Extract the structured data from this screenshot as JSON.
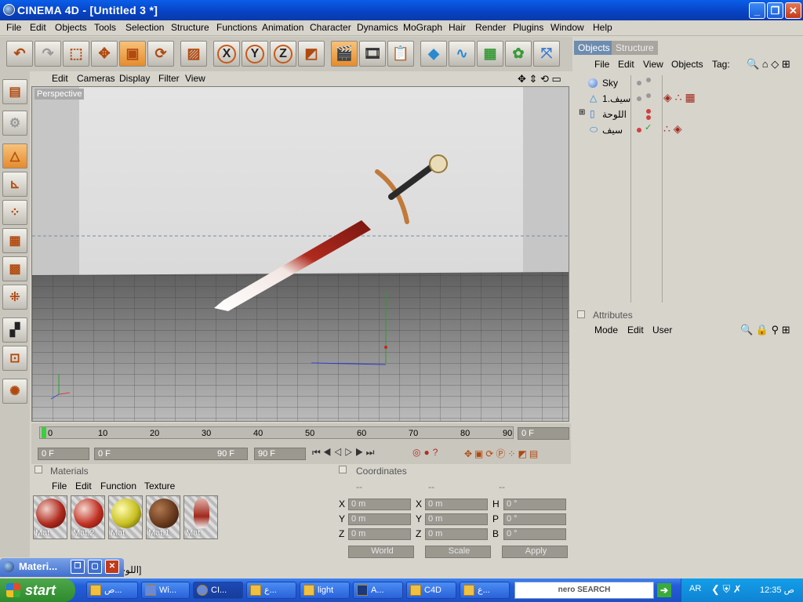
{
  "window": {
    "title": "CINEMA 4D - [Untitled 3 *]"
  },
  "menubar": [
    "File",
    "Edit",
    "Objects",
    "Tools",
    "Selection",
    "Structure",
    "Functions",
    "Animation",
    "Character",
    "Dynamics",
    "MoGraph",
    "Hair",
    "Render",
    "Plugins",
    "Window",
    "Help"
  ],
  "viewport": {
    "menu": [
      "Edit",
      "Cameras",
      "Display",
      "Filter",
      "View"
    ],
    "label": "Perspective"
  },
  "timeline": {
    "ticks": [
      "0",
      "10",
      "20",
      "30",
      "40",
      "50",
      "60",
      "70",
      "80",
      "90"
    ],
    "current_frame": "0 F",
    "start_frame": "0 F",
    "range_start": "0 F",
    "range_end": "90 F",
    "end_frame": "90 F"
  },
  "materials": {
    "title": "Materials",
    "menu": [
      "File",
      "Edit",
      "Function",
      "Texture"
    ],
    "items": [
      {
        "name": "Mat",
        "color": "#b02a1e"
      },
      {
        "name": "Mat.2",
        "color": "#c23224"
      },
      {
        "name": "Mat",
        "color": "#c8c020"
      },
      {
        "name": "Mat.1",
        "color": "#6a3a1e"
      },
      {
        "name": "Mat",
        "color": "#a0281c"
      }
    ]
  },
  "coordinates": {
    "title": "Coordinates",
    "headers": [
      "--",
      "--",
      "--"
    ],
    "rows": [
      {
        "a": "X",
        "av": "0 m",
        "b": "X",
        "bv": "0 m",
        "c": "H",
        "cv": "0 °"
      },
      {
        "a": "Y",
        "av": "0 m",
        "b": "Y",
        "bv": "0 m",
        "c": "P",
        "cv": "0 °"
      },
      {
        "a": "Z",
        "av": "0 m",
        "b": "Z",
        "bv": "0 m",
        "c": "B",
        "cv": "0 °"
      }
    ],
    "mode1": "World",
    "mode2": "Scale",
    "apply": "Apply"
  },
  "objects": {
    "tabs": [
      "Objects",
      "Structure"
    ],
    "menu": [
      "File",
      "Edit",
      "View",
      "Objects",
      "Tag:"
    ],
    "items": [
      {
        "name": "Sky"
      },
      {
        "name": "سيف.1"
      },
      {
        "name": "اللوحة"
      },
      {
        "name": "سيف"
      }
    ]
  },
  "attributes": {
    "title": "Attributes",
    "menu": [
      "Mode",
      "Edit",
      "User"
    ]
  },
  "status": {
    "text": "ct [اللوحة]"
  },
  "materi_window": {
    "title": "Materi..."
  },
  "taskbar": {
    "start": "start",
    "tasks": [
      "ص...",
      "Wi...",
      "CI...",
      "ع...",
      "light",
      "A...",
      "C4D",
      "ع..."
    ],
    "lang": "AR",
    "clock": "12:35 ص",
    "search": "nero SEARCH"
  }
}
